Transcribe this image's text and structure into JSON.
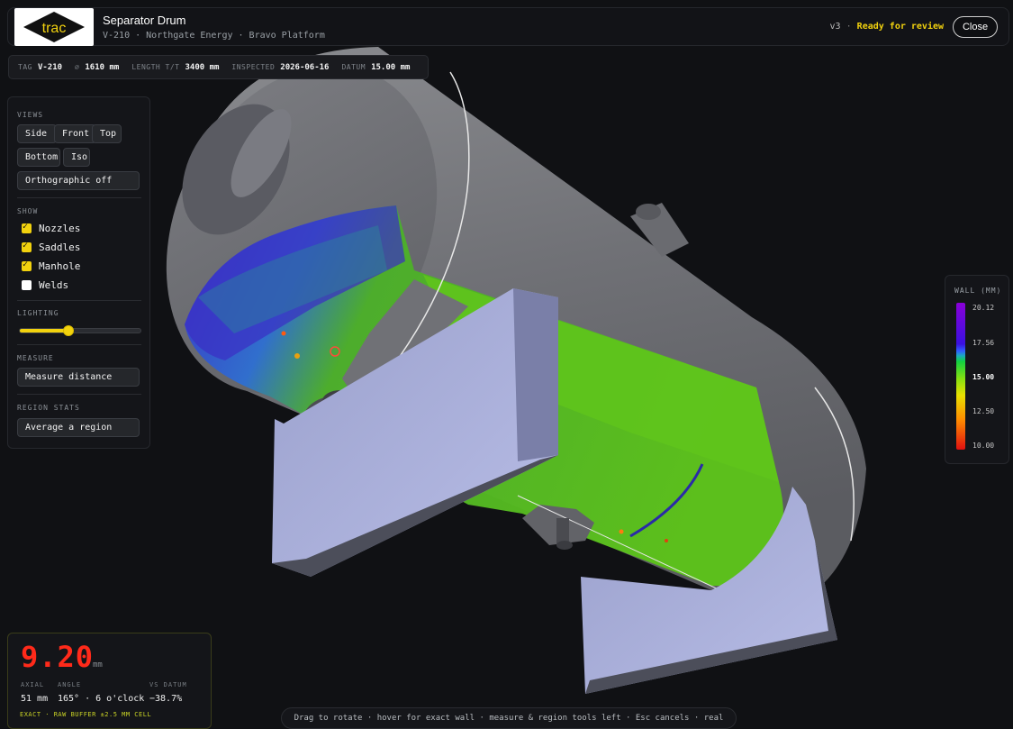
{
  "header": {
    "logo_text": "trac",
    "title": "Separator Drum",
    "subtitle": "V-210 · Northgate Energy · Bravo Platform",
    "version": "v3",
    "separator": "·",
    "status": "Ready for review",
    "close_label": "Close"
  },
  "info": {
    "tag_label": "TAG",
    "tag_value": "V-210",
    "dia_label": "⌀",
    "dia_value": "1610 mm",
    "length_label": "LENGTH T/T",
    "length_value": "3400 mm",
    "inspected_label": "INSPECTED",
    "inspected_value": "2026-06-16",
    "datum_label": "DATUM",
    "datum_value": "15.00 mm"
  },
  "panel": {
    "views_title": "VIEWS",
    "views": [
      "Side",
      "Front",
      "Top",
      "Bottom",
      "Iso"
    ],
    "ortho_label": "Orthographic off",
    "show_title": "SHOW",
    "show_items": [
      {
        "label": "Nozzles",
        "checked": true
      },
      {
        "label": "Saddles",
        "checked": true
      },
      {
        "label": "Manhole",
        "checked": true
      },
      {
        "label": "Welds",
        "checked": false
      }
    ],
    "lighting_title": "LIGHTING",
    "lighting_level": 0.4,
    "measure_title": "MEASURE",
    "measure_label": "Measure distance",
    "region_title": "REGION STATS",
    "region_label": "Average a region"
  },
  "legend": {
    "title": "WALL (MM)",
    "ticks": [
      "20.12",
      "17.56",
      "15.00",
      "12.50",
      "10.00"
    ]
  },
  "readout": {
    "value": "9.20",
    "unit": "mm",
    "axial_label": "AXIAL",
    "axial_value": "51 mm",
    "angle_label": "ANGLE",
    "angle_value": "165° · 6 o'clock",
    "datum_label": "VS DATUM",
    "datum_value": "−38.7%",
    "footer": "EXACT · RAW BUFFER ±2.5 MM CELL"
  },
  "hint": "Drag to rotate · hover for exact wall · measure & region tools left · Esc cancels · real vessel",
  "colors": {
    "accent": "#f2d20e",
    "critical": "#ff2a1a",
    "vessel": "#7a7b80",
    "saddle": "#a9aed8"
  }
}
